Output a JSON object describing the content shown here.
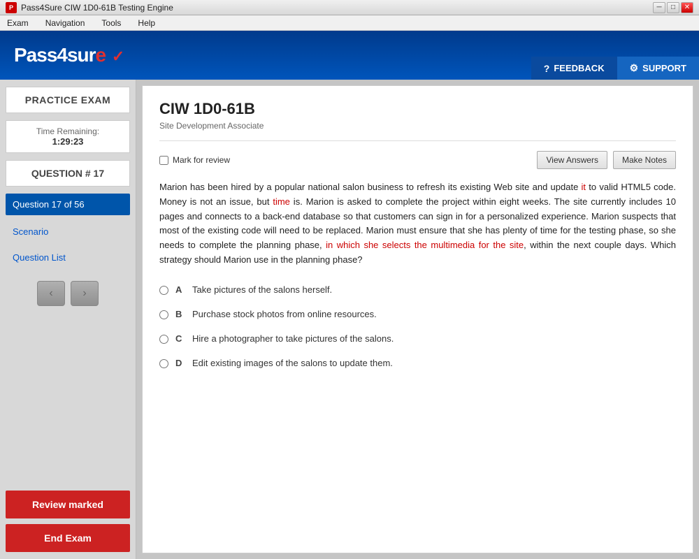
{
  "titlebar": {
    "title": "Pass4Sure CIW 1D0-61B Testing Engine",
    "icon": "P",
    "buttons": [
      "_",
      "□",
      "✕"
    ]
  },
  "menubar": {
    "items": [
      "Exam",
      "Navigation",
      "Tools",
      "Help"
    ]
  },
  "header": {
    "logo": "Pass4sure",
    "feedback_label": "FEEDBACK",
    "support_label": "SUPPORT"
  },
  "sidebar": {
    "practice_exam_label": "PRACTICE EXAM",
    "time_remaining_label": "Time Remaining:",
    "time_value": "1:29:23",
    "question_label": "QUESTION # 17",
    "nav_items": [
      {
        "label": "Question 17 of 56",
        "active": true
      },
      {
        "label": "Scenario",
        "active": false
      },
      {
        "label": "Question List",
        "active": false
      }
    ],
    "prev_arrow": "‹",
    "next_arrow": "›",
    "review_marked_label": "Review marked",
    "end_exam_label": "End Exam"
  },
  "content": {
    "exam_title": "CIW 1D0-61B",
    "exam_subtitle": "Site Development Associate",
    "mark_review_label": "Mark for review",
    "view_answers_label": "View Answers",
    "make_notes_label": "Make Notes",
    "question_text": "Marion has been hired by a popular national salon business to refresh its existing Web site and update it to valid HTML5 code. Money is not an issue, but time is. Marion is asked to complete the project within eight weeks. The site currently includes 10 pages and connects to a back-end database so that customers can sign in for a personalized experience. Marion suspects that most of the existing code will need to be replaced. Marion must ensure that she has plenty of time for the testing phase, so she needs to complete the planning phase, in which she selects the multimedia for the site, within the next couple days. Which strategy should Marion use in the planning phase?",
    "options": [
      {
        "letter": "A",
        "text": "Take pictures of the salons herself."
      },
      {
        "letter": "B",
        "text": "Purchase stock photos from online resources."
      },
      {
        "letter": "C",
        "text": "Hire a photographer to take pictures of the salons."
      },
      {
        "letter": "D",
        "text": "Edit existing images of the salons to update them."
      }
    ]
  }
}
